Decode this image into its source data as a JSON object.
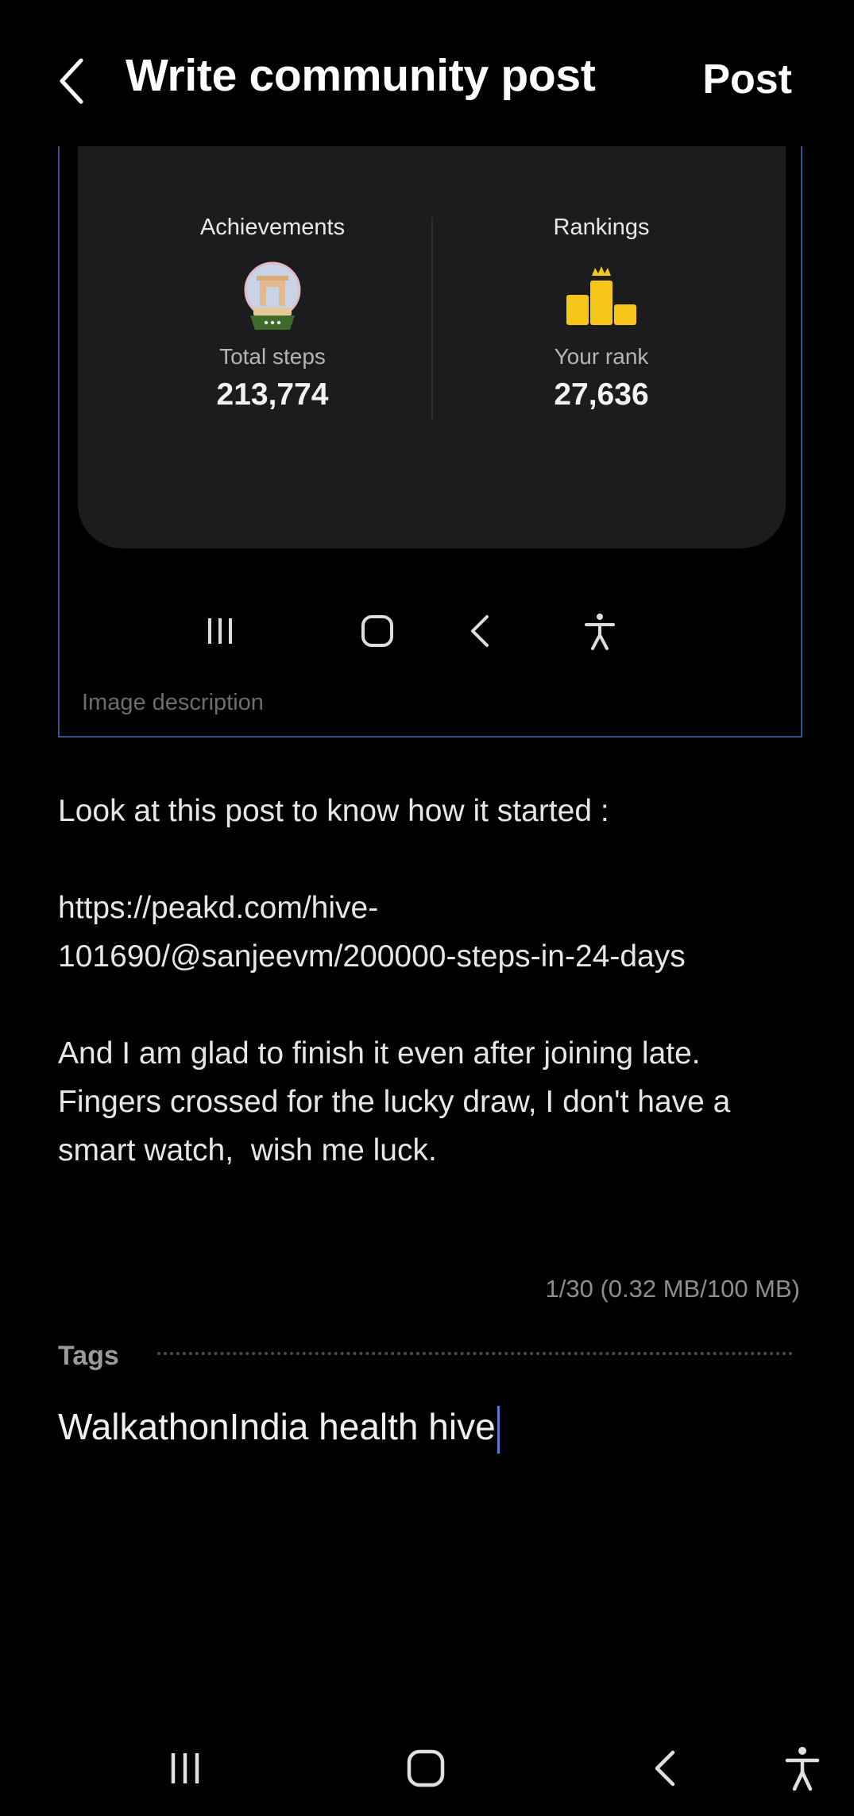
{
  "header": {
    "title": "Write community post",
    "post_label": "Post"
  },
  "attachment": {
    "achievements": {
      "heading": "Achievements",
      "label": "Total steps",
      "value": "213,774",
      "icon": "india-gate-globe-icon"
    },
    "rankings": {
      "heading": "Rankings",
      "label": "Your rank",
      "value": "27,636",
      "icon": "podium-crown-icon"
    },
    "image_description_placeholder": "Image description"
  },
  "body": {
    "line1": "Look at this post to know how it started :",
    "link_line1": "https://peakd.com/hive-",
    "link_line2": "101690/@sanjeevm/200000-steps-in-24-days",
    "para3_line1": "And I am glad to finish it even after joining late.",
    "para3_line2": "Fingers crossed for the lucky draw, I don't have a",
    "para3_line3": "smart watch,  wish me luck."
  },
  "counter": "1/30 (0.32 MB/100 MB)",
  "tags": {
    "label": "Tags",
    "value": "WalkathonIndia health hive"
  },
  "colors": {
    "background": "#000000",
    "card": "#1c1c1e",
    "frame_border": "#3a4f8c",
    "cursor": "#4a7bd8",
    "podium": "#f5c518"
  }
}
